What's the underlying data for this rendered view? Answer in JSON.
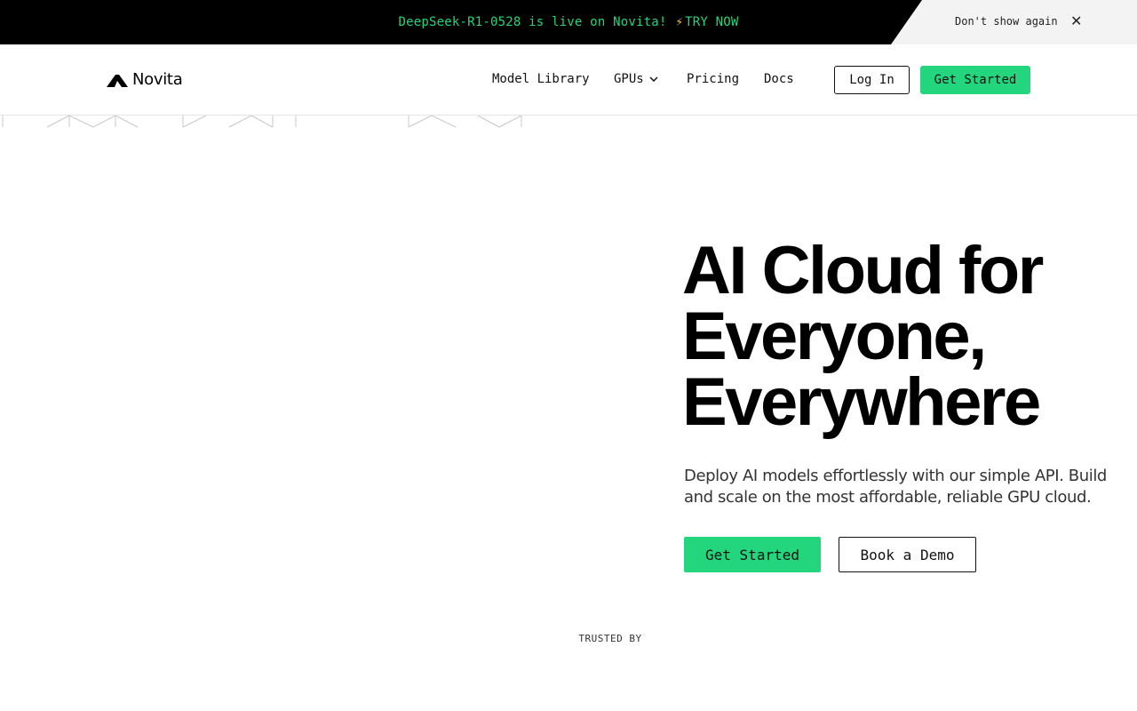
{
  "announcement": {
    "message": "DeepSeek-R1-0528 is live on Novita!",
    "bolt_icon": "⚡",
    "cta": "TRY NOW",
    "dismiss": "Don't show again",
    "close_icon": "✕",
    "accent_color": "#23d57c"
  },
  "header": {
    "logo_text": "Novita",
    "nav": {
      "model_library": "Model Library",
      "gpus": "GPUs",
      "pricing": "Pricing",
      "docs": "Docs"
    },
    "login": "Log In",
    "get_started": "Get Started"
  },
  "hero": {
    "title_line1": "AI Cloud for",
    "title_line2": "Everyone,",
    "title_line3": "Everywhere",
    "subtitle": "Deploy AI models effortlessly with our simple API. Build and scale on the most affordable, reliable GPU cloud.",
    "primary_cta": "Get Started",
    "secondary_cta": "Book a Demo"
  },
  "trusted_by": "TRUSTED BY",
  "colors": {
    "brand_green": "#23d57c",
    "announcement_bg": "#000000"
  }
}
